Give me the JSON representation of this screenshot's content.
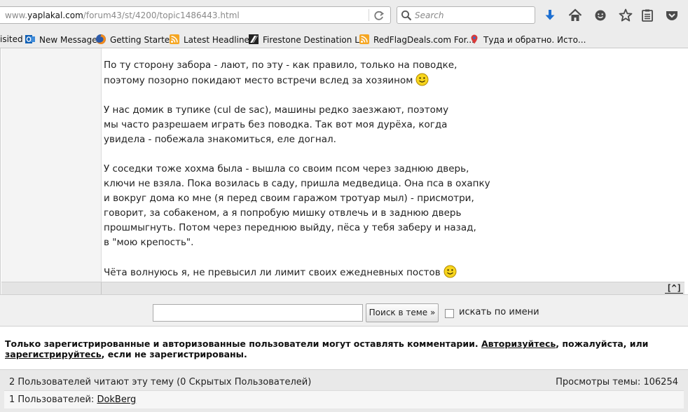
{
  "browser": {
    "url_prefix": "www.",
    "url_host": "yaplakal.com",
    "url_path": "/forum43/st/4200/topic1486443.html",
    "search_placeholder": "Search",
    "toolbar_icons": [
      "reload-icon",
      "magnifier-icon",
      "download-icon",
      "home-icon",
      "smiley-icon",
      "star-icon",
      "reading-list-icon",
      "pocket-icon"
    ]
  },
  "bookmarks": [
    {
      "label": "isited",
      "icon": "none"
    },
    {
      "label": "New Message",
      "icon": "outlook-icon"
    },
    {
      "label": "Getting Started",
      "icon": "firefox-icon"
    },
    {
      "label": "Latest Headlines",
      "icon": "rss-icon"
    },
    {
      "label": "Firestone Destination L...",
      "icon": "firestone-icon"
    },
    {
      "label": "RedFlagDeals.com For...",
      "icon": "rss-icon"
    },
    {
      "label": "Туда и обратно. Исто...",
      "icon": "map-pin-icon"
    }
  ],
  "post": {
    "paragraphs": [
      {
        "lines": [
          "По ту сторону забора - лают, по эту - как правило, только на поводке,",
          "поэтому позорно покидают место встречи вслед за хозяином"
        ],
        "smiley": true
      },
      {
        "lines": [
          "У нас домик в тупике (cul de sac), машины редко заезжают, поэтому",
          "мы часто разрешаем играть без поводка. Так вот моя дурёха, когда",
          "увидела - побежала знакомиться, еле догнал."
        ],
        "smiley": false
      },
      {
        "lines": [
          "У соседки тоже хохма была - вышла со своим псом через заднюю дверь,",
          "ключи не взяла. Пока возилась в саду, пришла медведица. Она пса в охапку",
          "и вокруг дома ко мне (я перед своим гаражом тротуар мыл) - присмотри,",
          "говорит, за собакеном, а я попробую мишку отвлечь и в заднюю дверь",
          "прошмыгнуть. Потом через переднюю выйду, пёса у тебя заберу и назад,",
          "в \"мою крепость\"."
        ],
        "smiley": false
      },
      {
        "lines": [
          "Чёта волнуюсь я, не превысил ли лимит своих ежедневных постов"
        ],
        "smiley": true
      }
    ],
    "to_top_label": "[^]"
  },
  "topic_search": {
    "query_value": "",
    "button_label": "Поиск в теме »",
    "checkbox_label": "искать по имени",
    "checkbox_checked": false
  },
  "notice": {
    "text_before": "Только зарегистрированные и авторизованные пользователи могут оставлять комментарии. ",
    "login_link": "Авторизуйтесь",
    "text_middle": ", пожалуйста, или ",
    "register_link": "зарегистрируйтесь",
    "text_after": ", если не зарегистрированы."
  },
  "stats": {
    "readers_text": "2 Пользователей читают эту тему (0 Скрытых Пользователей)",
    "views_text": "Просмотры темы: 106254",
    "users_prefix": "1 Пользователей: ",
    "users": [
      "DokBerg"
    ]
  }
}
